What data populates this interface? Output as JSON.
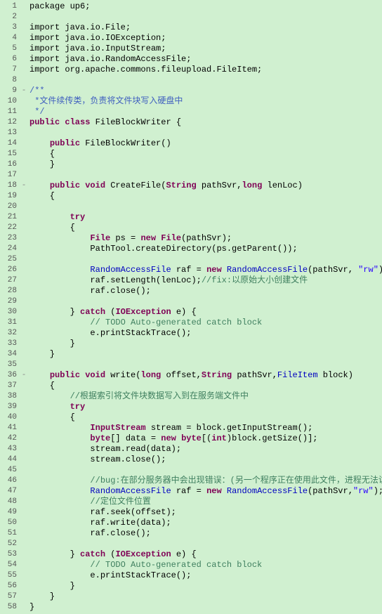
{
  "lines": [
    {
      "num": "1",
      "fold": " ",
      "content": [
        {
          "t": "package up6;",
          "c": "plain"
        }
      ]
    },
    {
      "num": "2",
      "fold": " ",
      "content": []
    },
    {
      "num": "3",
      "fold": " ",
      "content": [
        {
          "t": "import java.io.File;",
          "c": "plain"
        }
      ]
    },
    {
      "num": "4",
      "fold": " ",
      "content": [
        {
          "t": "import java.io.IOException;",
          "c": "plain"
        }
      ]
    },
    {
      "num": "5",
      "fold": " ",
      "content": [
        {
          "t": "import java.io.InputStream;",
          "c": "plain"
        }
      ]
    },
    {
      "num": "6",
      "fold": " ",
      "content": [
        {
          "t": "import java.io.RandomAccessFile;",
          "c": "plain"
        }
      ]
    },
    {
      "num": "7",
      "fold": " ",
      "content": [
        {
          "t": "import org.apache.commons.fileupload.FileItem;",
          "c": "plain"
        }
      ]
    },
    {
      "num": "8",
      "fold": " ",
      "content": []
    },
    {
      "num": "9",
      "fold": "-",
      "content": [
        {
          "t": "/**",
          "c": "javadoc"
        }
      ]
    },
    {
      "num": "10",
      "fold": " ",
      "content": [
        {
          "t": " *文件续传类，负责将文件块写入硬盘中",
          "c": "javadoc"
        }
      ]
    },
    {
      "num": "11",
      "fold": " ",
      "content": [
        {
          "t": " */",
          "c": "javadoc"
        }
      ]
    },
    {
      "num": "12",
      "fold": " ",
      "content": [
        {
          "t": "public class ",
          "c": "kw"
        },
        {
          "t": "FileBlockWriter",
          "c": "classname"
        },
        {
          "t": " {",
          "c": "plain"
        }
      ]
    },
    {
      "num": "13",
      "fold": " ",
      "content": []
    },
    {
      "num": "14",
      "fold": " ",
      "content": [
        {
          "t": "\t",
          "c": "plain"
        },
        {
          "t": "public ",
          "c": "kw"
        },
        {
          "t": "FileBlockWriter",
          "c": "classname"
        },
        {
          "t": "()",
          "c": "plain"
        }
      ]
    },
    {
      "num": "15",
      "fold": " ",
      "content": [
        {
          "t": "\t{",
          "c": "plain"
        }
      ]
    },
    {
      "num": "16",
      "fold": " ",
      "content": [
        {
          "t": "\t}",
          "c": "plain"
        }
      ]
    },
    {
      "num": "17",
      "fold": " ",
      "content": []
    },
    {
      "num": "18",
      "fold": "-",
      "content": [
        {
          "t": "\t",
          "c": "plain"
        },
        {
          "t": "public void ",
          "c": "kw"
        },
        {
          "t": "CreateFile(",
          "c": "plain"
        },
        {
          "t": "String ",
          "c": "type"
        },
        {
          "t": "pathSvr,",
          "c": "plain"
        },
        {
          "t": "long ",
          "c": "type"
        },
        {
          "t": "lenLoc)",
          "c": "plain"
        }
      ]
    },
    {
      "num": "19",
      "fold": " ",
      "content": [
        {
          "t": "\t{",
          "c": "plain"
        }
      ]
    },
    {
      "num": "20",
      "fold": " ",
      "content": []
    },
    {
      "num": "21",
      "fold": " ",
      "content": [
        {
          "t": "\t\t",
          "c": "plain"
        },
        {
          "t": "try",
          "c": "kw"
        }
      ]
    },
    {
      "num": "22",
      "fold": " ",
      "content": [
        {
          "t": "\t\t{",
          "c": "plain"
        }
      ]
    },
    {
      "num": "23",
      "fold": " ",
      "content": [
        {
          "t": "\t\t\t",
          "c": "plain"
        },
        {
          "t": "File",
          "c": "type"
        },
        {
          "t": " ps = ",
          "c": "plain"
        },
        {
          "t": "new ",
          "c": "kw"
        },
        {
          "t": "File",
          "c": "type"
        },
        {
          "t": "(pathSvr);",
          "c": "plain"
        }
      ]
    },
    {
      "num": "24",
      "fold": " ",
      "content": [
        {
          "t": "\t\t\t",
          "c": "plain"
        },
        {
          "t": "PathTool",
          "c": "classname"
        },
        {
          "t": ".createDirectory(ps.getParent());",
          "c": "plain"
        }
      ]
    },
    {
      "num": "25",
      "fold": " ",
      "content": []
    },
    {
      "num": "26",
      "fold": " ",
      "content": [
        {
          "t": "\t\t\t",
          "c": "plain"
        },
        {
          "t": "RandomAccessFile",
          "c": "cyan"
        },
        {
          "t": " raf = ",
          "c": "plain"
        },
        {
          "t": "new ",
          "c": "kw"
        },
        {
          "t": "RandomAccessFile",
          "c": "cyan"
        },
        {
          "t": "(pathSvr, ",
          "c": "plain"
        },
        {
          "t": "\"rw\"",
          "c": "str"
        },
        {
          "t": ");",
          "c": "plain"
        }
      ]
    },
    {
      "num": "27",
      "fold": " ",
      "content": [
        {
          "t": "\t\t\t",
          "c": "plain"
        },
        {
          "t": "raf.setLength(lenLoc);",
          "c": "plain"
        },
        {
          "t": "//fix:以原始大小创建文件",
          "c": "comment"
        }
      ]
    },
    {
      "num": "28",
      "fold": " ",
      "content": [
        {
          "t": "\t\t\t",
          "c": "plain"
        },
        {
          "t": "raf.close();",
          "c": "plain"
        }
      ]
    },
    {
      "num": "29",
      "fold": " ",
      "content": []
    },
    {
      "num": "30",
      "fold": " ",
      "content": [
        {
          "t": "\t\t} ",
          "c": "plain"
        },
        {
          "t": "catch ",
          "c": "kw"
        },
        {
          "t": "(",
          "c": "plain"
        },
        {
          "t": "IOException",
          "c": "type"
        },
        {
          "t": " e) {",
          "c": "plain"
        }
      ]
    },
    {
      "num": "31",
      "fold": " ",
      "content": [
        {
          "t": "\t\t\t",
          "c": "plain"
        },
        {
          "t": "// TODO Auto-generated catch block",
          "c": "comment"
        }
      ]
    },
    {
      "num": "32",
      "fold": " ",
      "content": [
        {
          "t": "\t\t\t",
          "c": "plain"
        },
        {
          "t": "e.printStackTrace();",
          "c": "plain"
        }
      ]
    },
    {
      "num": "33",
      "fold": " ",
      "content": [
        {
          "t": "\t\t}",
          "c": "plain"
        }
      ]
    },
    {
      "num": "34",
      "fold": " ",
      "content": [
        {
          "t": "\t}",
          "c": "plain"
        }
      ]
    },
    {
      "num": "35",
      "fold": " ",
      "content": []
    },
    {
      "num": "36",
      "fold": "-",
      "content": [
        {
          "t": "\t",
          "c": "plain"
        },
        {
          "t": "public void ",
          "c": "kw"
        },
        {
          "t": "write(",
          "c": "plain"
        },
        {
          "t": "long ",
          "c": "type"
        },
        {
          "t": "offset,",
          "c": "plain"
        },
        {
          "t": "String ",
          "c": "type"
        },
        {
          "t": "pathSvr,",
          "c": "plain"
        },
        {
          "t": "FileItem",
          "c": "cyan"
        },
        {
          "t": " block)",
          "c": "plain"
        }
      ]
    },
    {
      "num": "37",
      "fold": " ",
      "content": [
        {
          "t": "\t{",
          "c": "plain"
        }
      ]
    },
    {
      "num": "38",
      "fold": " ",
      "content": [
        {
          "t": "\t\t",
          "c": "plain"
        },
        {
          "t": "//根据索引将文件块数据写入到在服务端文件中",
          "c": "comment"
        }
      ]
    },
    {
      "num": "39",
      "fold": " ",
      "content": [
        {
          "t": "\t\t",
          "c": "plain"
        },
        {
          "t": "try",
          "c": "kw"
        }
      ]
    },
    {
      "num": "40",
      "fold": " ",
      "content": [
        {
          "t": "\t\t{",
          "c": "plain"
        }
      ]
    },
    {
      "num": "41",
      "fold": " ",
      "content": [
        {
          "t": "\t\t\t",
          "c": "plain"
        },
        {
          "t": "InputStream",
          "c": "type"
        },
        {
          "t": " stream = block.getInputStream();",
          "c": "plain"
        }
      ]
    },
    {
      "num": "42",
      "fold": " ",
      "content": [
        {
          "t": "\t\t\t",
          "c": "plain"
        },
        {
          "t": "byte",
          "c": "type"
        },
        {
          "t": "[] data = ",
          "c": "plain"
        },
        {
          "t": "new ",
          "c": "kw"
        },
        {
          "t": "byte",
          "c": "type"
        },
        {
          "t": "[(",
          "c": "plain"
        },
        {
          "t": "int",
          "c": "type"
        },
        {
          "t": ")block.getSize()];",
          "c": "plain"
        }
      ]
    },
    {
      "num": "43",
      "fold": " ",
      "content": [
        {
          "t": "\t\t\t",
          "c": "plain"
        },
        {
          "t": "stream.read(data);",
          "c": "plain"
        }
      ]
    },
    {
      "num": "44",
      "fold": " ",
      "content": [
        {
          "t": "\t\t\t",
          "c": "plain"
        },
        {
          "t": "stream.close();",
          "c": "plain"
        }
      ]
    },
    {
      "num": "45",
      "fold": " ",
      "content": []
    },
    {
      "num": "46",
      "fold": " ",
      "content": [
        {
          "t": "\t\t\t",
          "c": "plain"
        },
        {
          "t": "//bug:在部分服务器中会出现错误：(另一个程序正在使用此文件，进程无法访问。)",
          "c": "comment"
        }
      ]
    },
    {
      "num": "47",
      "fold": " ",
      "content": [
        {
          "t": "\t\t\t",
          "c": "plain"
        },
        {
          "t": "RandomAccessFile",
          "c": "cyan"
        },
        {
          "t": " raf = ",
          "c": "plain"
        },
        {
          "t": "new ",
          "c": "kw"
        },
        {
          "t": "RandomAccessFile",
          "c": "cyan"
        },
        {
          "t": "(pathSvr,",
          "c": "plain"
        },
        {
          "t": "\"rw\"",
          "c": "str"
        },
        {
          "t": ");",
          "c": "plain"
        }
      ]
    },
    {
      "num": "48",
      "fold": " ",
      "content": [
        {
          "t": "\t\t\t",
          "c": "plain"
        },
        {
          "t": "//定位文件位置",
          "c": "comment"
        }
      ]
    },
    {
      "num": "49",
      "fold": " ",
      "content": [
        {
          "t": "\t\t\t",
          "c": "plain"
        },
        {
          "t": "raf.seek(offset);",
          "c": "plain"
        }
      ]
    },
    {
      "num": "50",
      "fold": " ",
      "content": [
        {
          "t": "\t\t\t",
          "c": "plain"
        },
        {
          "t": "raf.write(data);",
          "c": "plain"
        }
      ]
    },
    {
      "num": "51",
      "fold": " ",
      "content": [
        {
          "t": "\t\t\t",
          "c": "plain"
        },
        {
          "t": "raf.close();",
          "c": "plain"
        }
      ]
    },
    {
      "num": "52",
      "fold": " ",
      "content": []
    },
    {
      "num": "53",
      "fold": " ",
      "content": [
        {
          "t": "\t\t} ",
          "c": "plain"
        },
        {
          "t": "catch ",
          "c": "kw"
        },
        {
          "t": "(",
          "c": "plain"
        },
        {
          "t": "IOException",
          "c": "type"
        },
        {
          "t": " e) {",
          "c": "plain"
        }
      ]
    },
    {
      "num": "54",
      "fold": " ",
      "content": [
        {
          "t": "\t\t\t",
          "c": "plain"
        },
        {
          "t": "// TODO Auto-generated catch block",
          "c": "comment"
        }
      ]
    },
    {
      "num": "55",
      "fold": " ",
      "content": [
        {
          "t": "\t\t\t",
          "c": "plain"
        },
        {
          "t": "e.printStackTrace();",
          "c": "plain"
        }
      ]
    },
    {
      "num": "56",
      "fold": " ",
      "content": [
        {
          "t": "\t\t}",
          "c": "plain"
        }
      ]
    },
    {
      "num": "57",
      "fold": " ",
      "content": [
        {
          "t": "\t}",
          "c": "plain"
        }
      ]
    },
    {
      "num": "58",
      "fold": " ",
      "content": [
        {
          "t": "}",
          "c": "plain"
        }
      ]
    }
  ]
}
